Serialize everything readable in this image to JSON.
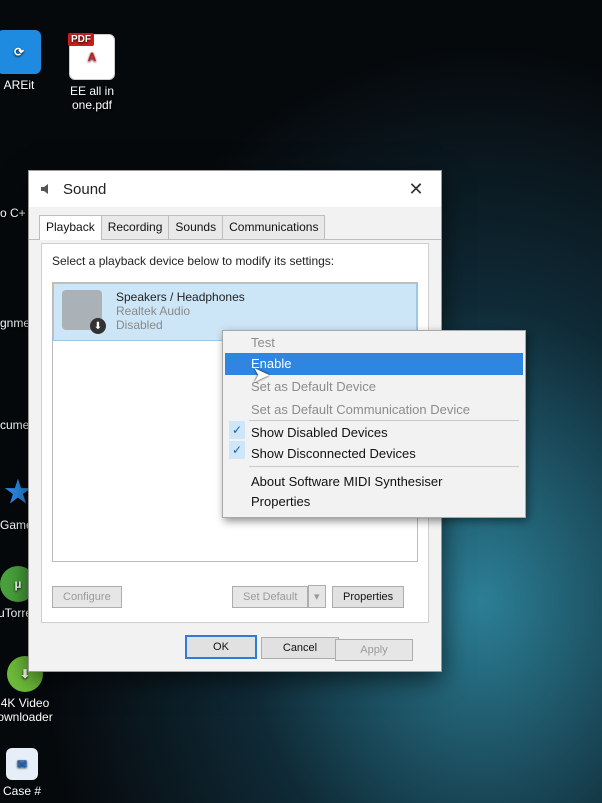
{
  "desktop": {
    "icons": [
      {
        "label": "AREit"
      },
      {
        "label": "EE all in\none.pdf",
        "badge": "PDF"
      },
      {
        "label": "Games"
      },
      {
        "label": "uTorrent"
      },
      {
        "label": "4K Video\nownloader"
      },
      {
        "label": "Case #"
      }
    ],
    "left_fragments": [
      "o C+",
      "gnme",
      "cumen"
    ]
  },
  "window": {
    "title": "Sound",
    "close_glyph": "✕",
    "tabs": [
      "Playback",
      "Recording",
      "Sounds",
      "Communications"
    ],
    "instruction": "Select a playback device below to modify its settings:",
    "device": {
      "name": "Speakers / Headphones",
      "driver": "Realtek Audio",
      "status": "Disabled"
    },
    "buttons": {
      "configure": "Configure",
      "set_default": "Set Default",
      "dropdown": "▾",
      "properties": "Properties",
      "ok": "OK",
      "cancel": "Cancel",
      "apply": "Apply"
    }
  },
  "context_menu": {
    "items": [
      {
        "label": "Test",
        "state": "disabled"
      },
      {
        "label": "Enable",
        "state": "highlighted"
      },
      {
        "label": "Set as Default Device",
        "state": "disabled"
      },
      {
        "label": "Set as Default Communication Device",
        "state": "disabled"
      },
      {
        "label": "Show Disabled Devices",
        "checked": true
      },
      {
        "label": "Show Disconnected Devices",
        "checked": true
      },
      {
        "label": "About Software MIDI Synthesiser"
      },
      {
        "label": "Properties"
      }
    ],
    "check_glyph": "✓"
  },
  "colors": {
    "highlight": "#2f86e0",
    "selection_bg": "#cde6f7"
  }
}
